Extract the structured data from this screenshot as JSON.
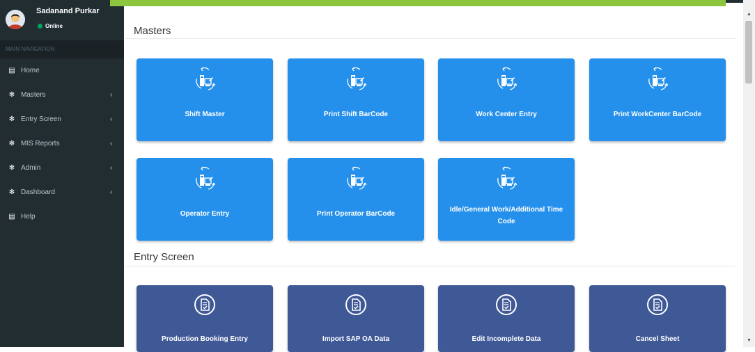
{
  "user": {
    "name": "Sadanand Purkar",
    "status": "Online"
  },
  "sidebar": {
    "header": "MAIN NAVIGATION",
    "items": [
      {
        "label": "Home",
        "icon": "book-icon",
        "has_submenu": false
      },
      {
        "label": "Masters",
        "icon": "dashboard-icon",
        "has_submenu": true
      },
      {
        "label": "Entry Screen",
        "icon": "dashboard-icon",
        "has_submenu": true
      },
      {
        "label": "MIS Reports",
        "icon": "dashboard-icon",
        "has_submenu": true
      },
      {
        "label": "Admin",
        "icon": "dashboard-icon",
        "has_submenu": true
      },
      {
        "label": "Dashboard",
        "icon": "dashboard-icon",
        "has_submenu": true
      },
      {
        "label": "Help",
        "icon": "book-icon",
        "has_submenu": false
      }
    ]
  },
  "sections": {
    "masters": {
      "title": "Masters",
      "tiles": [
        {
          "label": "Shift Master"
        },
        {
          "label": "Print Shift BarCode"
        },
        {
          "label": "Work Center Entry"
        },
        {
          "label": "Print WorkCenter BarCode"
        },
        {
          "label": "Operator Entry"
        },
        {
          "label": "Print Operator BarCode"
        },
        {
          "label": "Idle/General Work/Additional Time Code"
        }
      ]
    },
    "entry_screen": {
      "title": "Entry Screen",
      "tiles": [
        {
          "label": "Production Booking Entry"
        },
        {
          "label": "Import SAP OA Data"
        },
        {
          "label": "Edit Incomplete Data"
        },
        {
          "label": "Cancel Sheet"
        }
      ]
    }
  },
  "colors": {
    "sidebar_bg": "#222d32",
    "accent_bar": "#8cc63f",
    "master_tile": "#2590eb",
    "entry_tile": "#3f5896",
    "online": "#00a65a"
  }
}
